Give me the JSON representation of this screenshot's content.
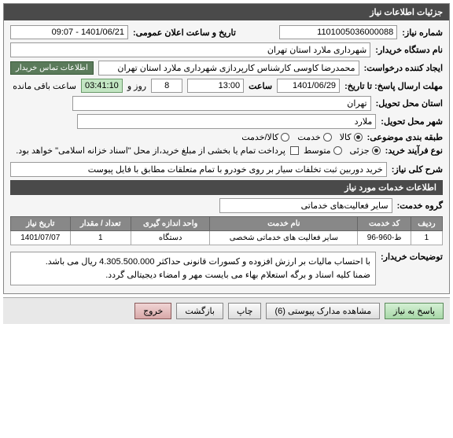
{
  "panel_title": "جزئیات اطلاعات نیاز",
  "fields": {
    "need_no_label": "شماره نیاز",
    "need_no": "1101005036000088",
    "announce_label": "تاریخ و ساعت اعلان عمومی",
    "announce_value": "1401/06/21 - 09:07",
    "buyer_label": "نام دستگاه خریدار",
    "buyer_value": "شهرداری ملارد استان تهران",
    "requester_label": "ایجاد کننده درخواست",
    "requester_value": "محمدرضا کاوسی کارشناس کارپردازی شهرداری ملارد استان تهران",
    "contact_btn": "اطلاعات تماس خریدار",
    "deadline_label": "مهلت ارسال پاسخ: تا تاریخ",
    "deadline_date": "1401/06/29",
    "time_label": "ساعت",
    "deadline_time": "13:00",
    "days_val": "8",
    "days_suffix": "روز و",
    "countdown": "03:41:10",
    "remain_suffix": "ساعت باقی مانده",
    "province_label": "استان محل تحویل",
    "province_value": "تهران",
    "city_label": "شهر محل تحویل",
    "city_value": "ملارد",
    "subject_type_label": "طبقه بندی موضوعی",
    "opt_goods": "کالا",
    "opt_service": "خدمت",
    "opt_goods_service": "کالا/خدمت",
    "process_label": "نوع فرآیند خرید",
    "opt_partial": "جزئی",
    "opt_medium": "متوسط",
    "payment_note": "پرداخت تمام یا بخشی از مبلغ خرید،از محل \"اسناد خزانه اسلامی\" خواهد بود.",
    "general_desc_label": "شرح کلی نیاز",
    "general_desc_value": "خرید دوربین ثبت تخلفات سیار بر روی خودرو با تمام متعلقات مطابق با فایل پیوست",
    "services_header": "اطلاعات خدمات مورد نیاز",
    "service_group_label": "گروه خدمت",
    "service_group_value": "سایر فعالیت‌های خدماتی",
    "buyer_notes_label": "توضیحات خریدار",
    "buyer_notes_line1": "با احتساب مالیات بر ارزش افزوده و کسورات قانونی حداکثر 4.305.500.000 ریال می باشد.",
    "buyer_notes_line2": "ضمنا  کلیه اسناد و برگه استعلام بهاء می بایست مهر و امضاء دیجیتالی گردد."
  },
  "table": {
    "headers": [
      "ردیف",
      "کد خدمت",
      "نام خدمت",
      "واحد اندازه گیری",
      "تعداد / مقدار",
      "تاریخ نیاز"
    ],
    "rows": [
      [
        "1",
        "ط-960-96",
        "سایر فعالیت های خدماتی شخصی",
        "دستگاه",
        "1",
        "1401/07/07"
      ]
    ]
  },
  "footer": {
    "respond": "پاسخ به نیاز",
    "attachments": "مشاهده مدارک پیوستی (6)",
    "print": "چاپ",
    "back": "بازگشت",
    "exit": "خروج"
  }
}
